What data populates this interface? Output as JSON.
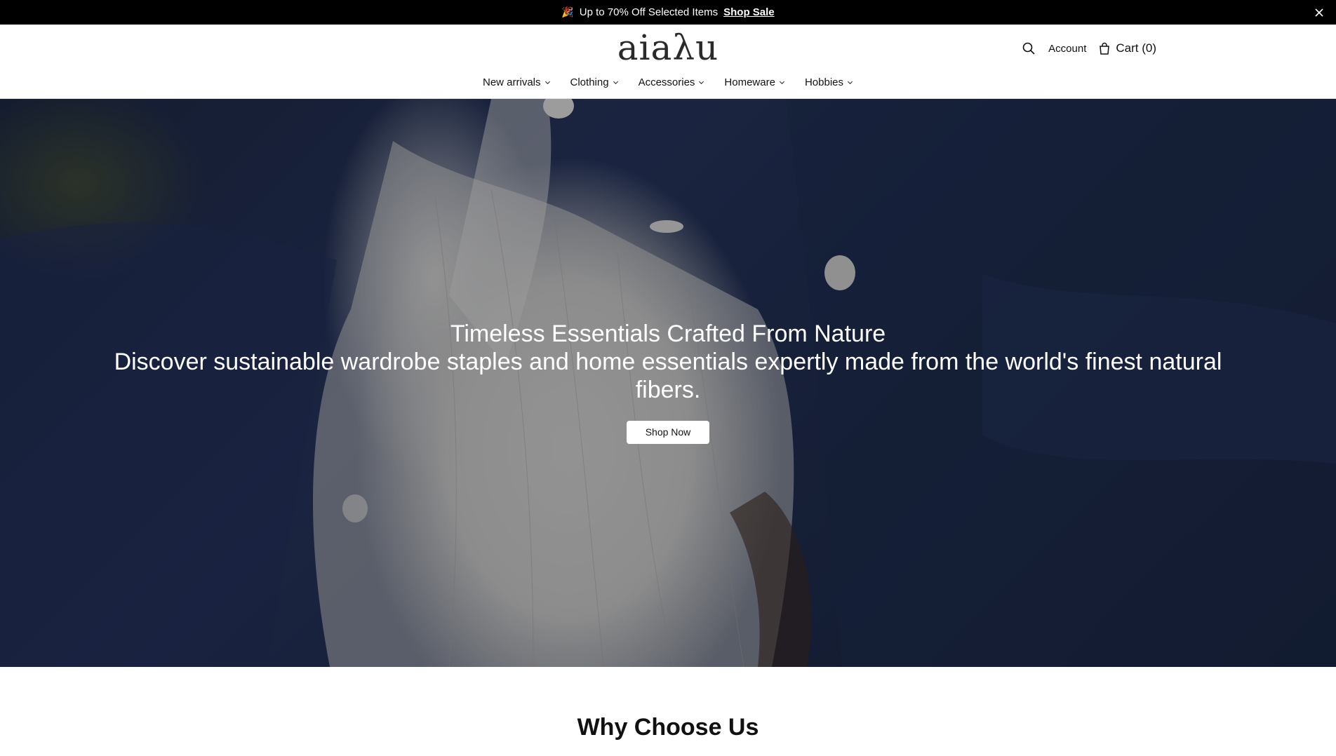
{
  "announcement": {
    "emoji": "🎉",
    "text": "Up to 70% Off Selected Items",
    "link": "Shop Sale"
  },
  "header": {
    "logo": "aiaλu",
    "account_label": "Account",
    "cart_label": "Cart (0)"
  },
  "nav": [
    {
      "label": "New arrivals"
    },
    {
      "label": "Clothing"
    },
    {
      "label": "Accessories"
    },
    {
      "label": "Homeware"
    },
    {
      "label": "Hobbies"
    }
  ],
  "hero": {
    "title": "Timeless Essentials Crafted From Nature",
    "subtitle": "Discover sustainable wardrobe staples and home essentials expertly made from the world's finest natural fibers.",
    "button": "Shop Now"
  },
  "why": {
    "title": "Why Choose Us"
  },
  "icons": {
    "search": "search-icon",
    "cart": "bag-icon",
    "close": "close-icon",
    "chevron": "chevron-down-icon"
  },
  "colors": {
    "announcement_bg": "#000000",
    "hero_navy": "#1f2c4d",
    "button_bg": "#ffffff"
  }
}
